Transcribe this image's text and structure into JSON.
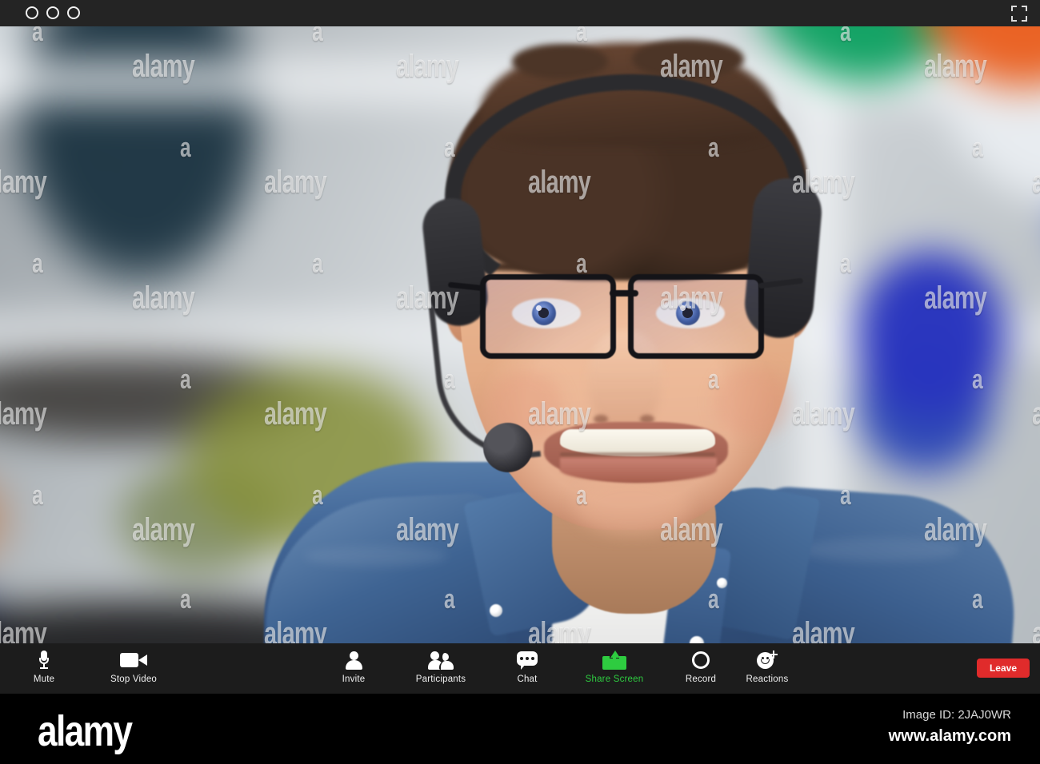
{
  "window": {
    "controls": [
      {
        "name": "close",
        "icon": "circle-outline-icon"
      },
      {
        "name": "minimize",
        "icon": "circle-outline-icon"
      },
      {
        "name": "maximize",
        "icon": "circle-outline-icon"
      }
    ],
    "fullscreen_icon": "fullscreen-expand-icon",
    "chrome_color": "#242424"
  },
  "video": {
    "participant_description": "Smiling young man wearing glasses and a headset with boom microphone, in a denim shirt over a white t-shirt, blurred office with bookshelf behind",
    "background_description": "Blurred office interior with white shelving, blue book block, green and orange books, a plant and a dark desk"
  },
  "toolbar": {
    "background_color": "#1c1c1c",
    "items": [
      {
        "label": "Mute",
        "icon": "microphone-icon",
        "active": false
      },
      {
        "label": "Stop Video",
        "icon": "video-camera-icon",
        "active": false
      },
      {
        "label": "Invite",
        "icon": "person-icon",
        "active": false
      },
      {
        "label": "Participants",
        "icon": "people-icon",
        "active": false
      },
      {
        "label": "Chat",
        "icon": "chat-bubble-icon",
        "active": false
      },
      {
        "label": "Share Screen",
        "icon": "share-screen-icon",
        "active": true
      },
      {
        "label": "Record",
        "icon": "record-circle-icon",
        "active": false
      },
      {
        "label": "Reactions",
        "icon": "smiley-plus-icon",
        "active": false
      }
    ],
    "leave_label": "Leave",
    "leave_color": "#e02b2b",
    "active_color": "#2ecc40"
  },
  "footer": {
    "logo": "alamy",
    "image_id": "Image ID: 2JAJ0WR",
    "url": "www.alamy.com",
    "background_color": "#000000"
  },
  "watermarks": {
    "letter": "a",
    "word": "alamy"
  }
}
